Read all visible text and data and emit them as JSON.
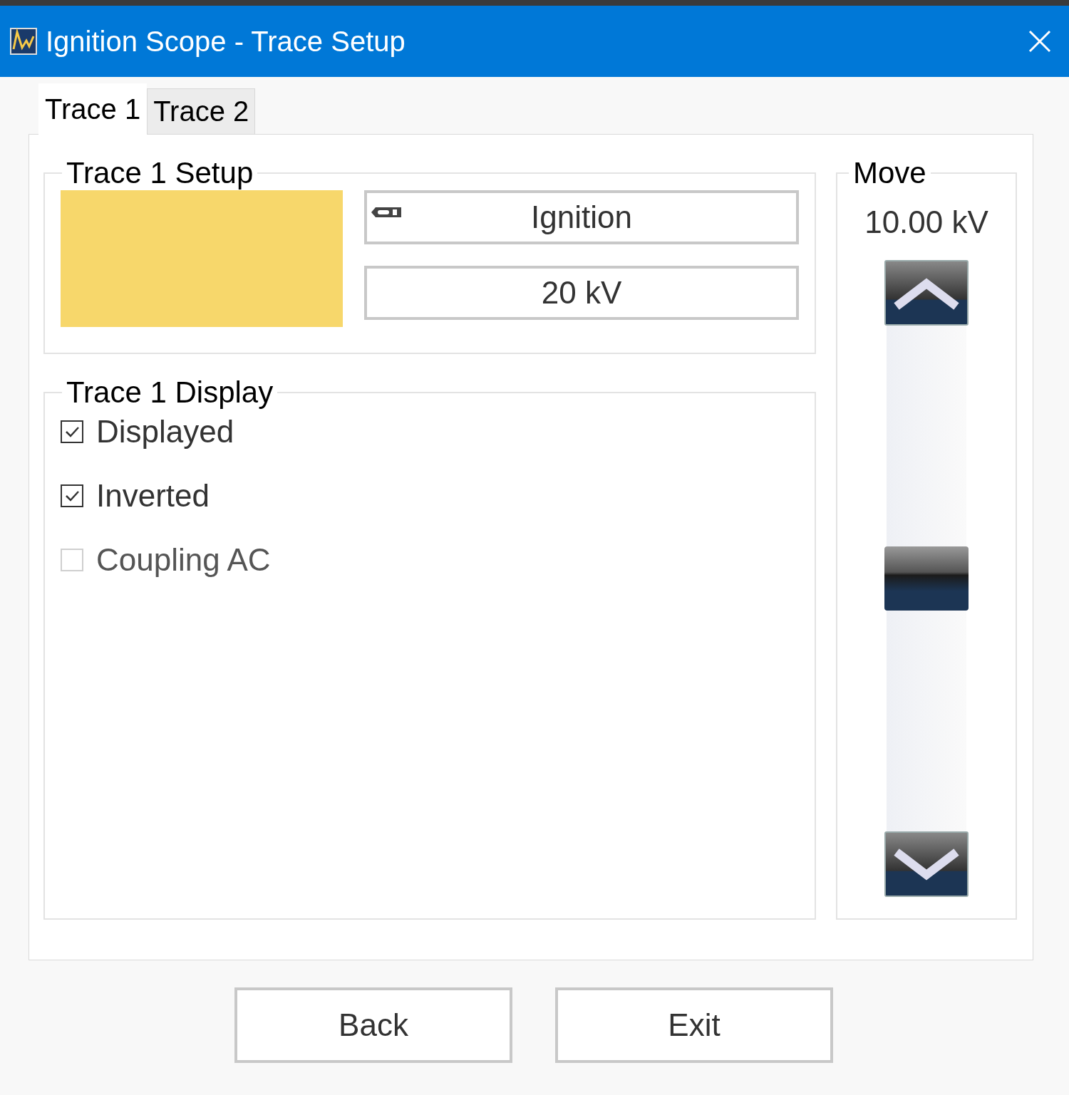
{
  "window": {
    "title": "Ignition Scope - Trace Setup"
  },
  "tabs": [
    {
      "label": "Trace 1",
      "selected": true
    },
    {
      "label": "Trace 2",
      "selected": false
    }
  ],
  "setup": {
    "title": "Trace 1 Setup",
    "color": "#f7d76b",
    "probe": "Ignition",
    "range": "20 kV"
  },
  "display": {
    "title": "Trace 1 Display",
    "options": [
      {
        "label": "Displayed",
        "checked": true,
        "disabled": false
      },
      {
        "label": "Inverted",
        "checked": true,
        "disabled": false
      },
      {
        "label": "Coupling AC",
        "checked": false,
        "disabled": true
      }
    ]
  },
  "move": {
    "title": "Move",
    "reading": "10.00 kV",
    "level": 0.5
  },
  "buttons": [
    "Back",
    "Exit"
  ]
}
